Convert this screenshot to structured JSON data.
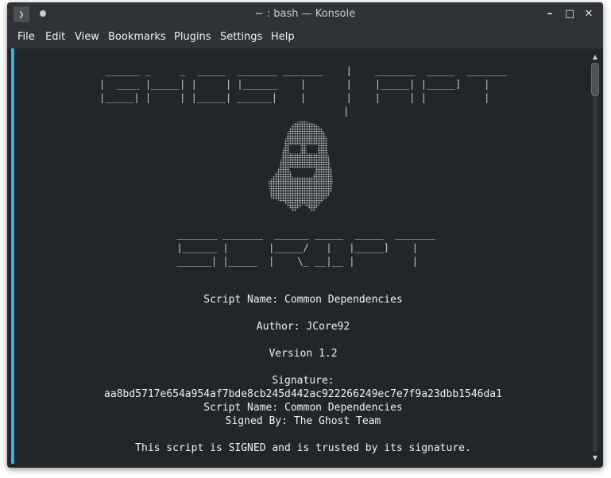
{
  "window": {
    "title": "~ : bash — Konsole",
    "app_icon_glyph": "❯",
    "controls": {
      "minimize": "–",
      "maximize": "□",
      "close": "✕"
    }
  },
  "menubar": {
    "items": [
      "File",
      "Edit",
      "View",
      "Bookmarks",
      "Plugins",
      "Settings",
      "Help"
    ]
  },
  "terminal": {
    "banner_ghost": [
      " ______ _     _  _____  _______ _______    |    _______  _____  _______",
      "|  ____ |_____| |     | |______    |       |    |_____| |_____]    |   ",
      "|_____| |     | |_____| ______|    |       |    |     | |          |   ",
      "                                           |                            "
    ],
    "banner_script": [
      " _______ _______  ______ _____  _____  _______",
      " |______ |       |_____/   |   |_____]    |   ",
      " ______| |_____  |    \\_ __|__ |          |   "
    ],
    "script_name_line": "Script Name: Common Dependencies",
    "author_line": "Author: JCore92",
    "version_line": "Version 1.2",
    "signature_label": "Signature:",
    "signature_hash": "aa8bd5717e654a954af7bde8cb245d442ac922266249ec7e7f9a23dbb1546da1",
    "script_name_line_2": "Script Name: Common Dependencies",
    "signed_by_line": "Signed By: The Ghost Team",
    "trust_line": "This script is SIGNED and is trusted by its signature."
  },
  "colors": {
    "terminal_bg": "#232629",
    "chrome_bg": "#2f3337",
    "text": "#eff0f1",
    "accent": "#3daee9"
  }
}
